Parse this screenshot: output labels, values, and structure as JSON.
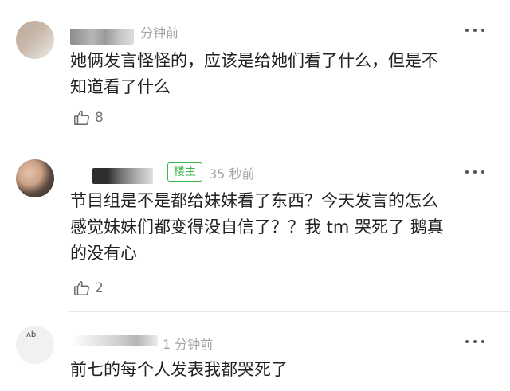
{
  "comments": [
    {
      "time": "分钟前",
      "text": "她俩发言怪怪的，应该是给她们看了什么，但是不\n知道看了什么",
      "likes": "8",
      "more_icon": "more-dots-icon",
      "like_icon": "thumbs-up-icon"
    },
    {
      "badge": "楼主",
      "time": "35 秒前",
      "text": "节目组是不是都给妹妹看了东西？今天发言的怎么\n感觉妹妹们都变得没自信了？？我 tm 哭死了 鹅真\n的没有心",
      "likes": "2",
      "more_icon": "more-dots-icon",
      "like_icon": "thumbs-up-icon"
    },
    {
      "time": "1 分钟前",
      "text": "前七的每个人发表我都哭死了",
      "more_icon": "more-dots-icon"
    }
  ],
  "colors": {
    "op_badge": "#3bb54a",
    "meta_text": "#a3a3a3",
    "body_text": "#222222"
  }
}
